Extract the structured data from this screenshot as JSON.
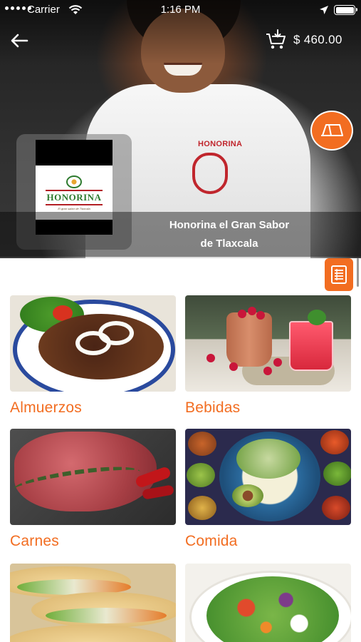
{
  "status_bar": {
    "carrier": "Carrier",
    "time": "1:16 PM"
  },
  "header": {
    "cart_total": "$ 460.00"
  },
  "restaurant": {
    "logo_text": "HONORINA",
    "logo_tagline": "El gran sabor de Tlaxcala",
    "name_line1": "Honorina el Gran Sabor",
    "name_line2": "de Tlaxcala",
    "chef_jacket_text": "HONORINA"
  },
  "categories": [
    {
      "label": "Almuerzos"
    },
    {
      "label": "Bebidas"
    },
    {
      "label": "Carnes"
    },
    {
      "label": "Comida"
    },
    {
      "label": ""
    },
    {
      "label": ""
    }
  ],
  "colors": {
    "accent": "#f26d21",
    "label": "#f26d21"
  },
  "icons": {
    "back": "arrow-left-icon",
    "cart": "cart-download-icon",
    "map": "map-icon",
    "menu": "list-icon"
  }
}
